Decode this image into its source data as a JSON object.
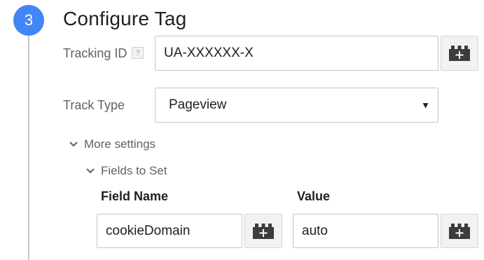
{
  "step": {
    "number": "3",
    "title": "Configure Tag"
  },
  "tracking_id": {
    "label": "Tracking ID",
    "help": "?",
    "value": "UA-XXXXXX-X"
  },
  "track_type": {
    "label": "Track Type",
    "selected": "Pageview"
  },
  "more_settings": {
    "label": "More settings",
    "expanded": true
  },
  "fields_to_set": {
    "label": "Fields to Set",
    "expanded": true,
    "columns": {
      "field_name": "Field Name",
      "value": "Value"
    },
    "rows": [
      {
        "field_name": "cookieDomain",
        "value": "auto"
      }
    ]
  },
  "icons": {
    "variable_picker": "variable-picker-icon",
    "dropdown": "dropdown-arrow-icon",
    "chevron": "chevron-down-icon"
  },
  "colors": {
    "accent": "#4285f4",
    "border": "#c6c6c6",
    "timeline": "#c8c8c8"
  }
}
